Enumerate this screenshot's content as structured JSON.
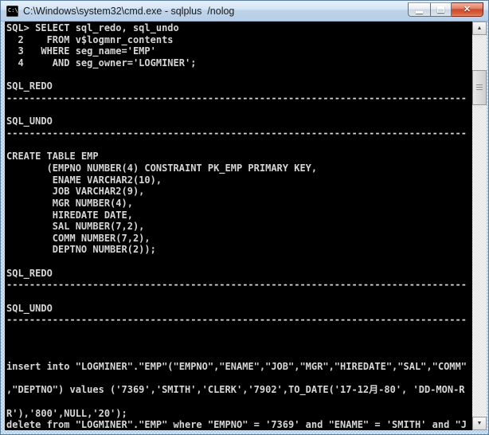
{
  "window": {
    "title": "C:\\Windows\\system32\\cmd.exe - sqlplus  /nolog",
    "cmd_icon_text": "C:\\",
    "controls": {
      "close_glyph": "✕"
    }
  },
  "console": {
    "lines": [
      "SQL> SELECT sql_redo, sql_undo",
      "  2    FROM v$logmnr_contents",
      "  3   WHERE seg_name='EMP'",
      "  4     AND seg_owner='LOGMINER';",
      "",
      "SQL_REDO",
      "--------------------------------------------------------------------------------",
      "",
      "SQL_UNDO",
      "--------------------------------------------------------------------------------",
      "",
      "CREATE TABLE EMP",
      "       (EMPNO NUMBER(4) CONSTRAINT PK_EMP PRIMARY KEY,",
      "        ENAME VARCHAR2(10),",
      "        JOB VARCHAR2(9),",
      "        MGR NUMBER(4),",
      "        HIREDATE DATE,",
      "        SAL NUMBER(7,2),",
      "        COMM NUMBER(7,2),",
      "        DEPTNO NUMBER(2));",
      "",
      "SQL_REDO",
      "--------------------------------------------------------------------------------",
      "",
      "SQL_UNDO",
      "--------------------------------------------------------------------------------",
      "",
      "",
      "",
      "insert into \"LOGMINER\".\"EMP\"(\"EMPNO\",\"ENAME\",\"JOB\",\"MGR\",\"HIREDATE\",\"SAL\",\"COMM\"",
      "",
      ",\"DEPTNO\") values ('7369','SMITH','CLERK','7902',TO_DATE('17-12月-80', 'DD-MON-R",
      "",
      "R'),'800',NULL,'20');",
      "delete from \"LOGMINER\".\"EMP\" where \"EMPNO\" = '7369' and \"ENAME\" = 'SMITH' and \"J"
    ]
  },
  "scrollbar": {
    "up_glyph": "▲",
    "down_glyph": "▼"
  },
  "colors": {
    "console_background": "#000000",
    "console_text": "#d6d6d6",
    "frame_blue": "#bcd3ea",
    "close_button_red": "#cc4a2d"
  }
}
